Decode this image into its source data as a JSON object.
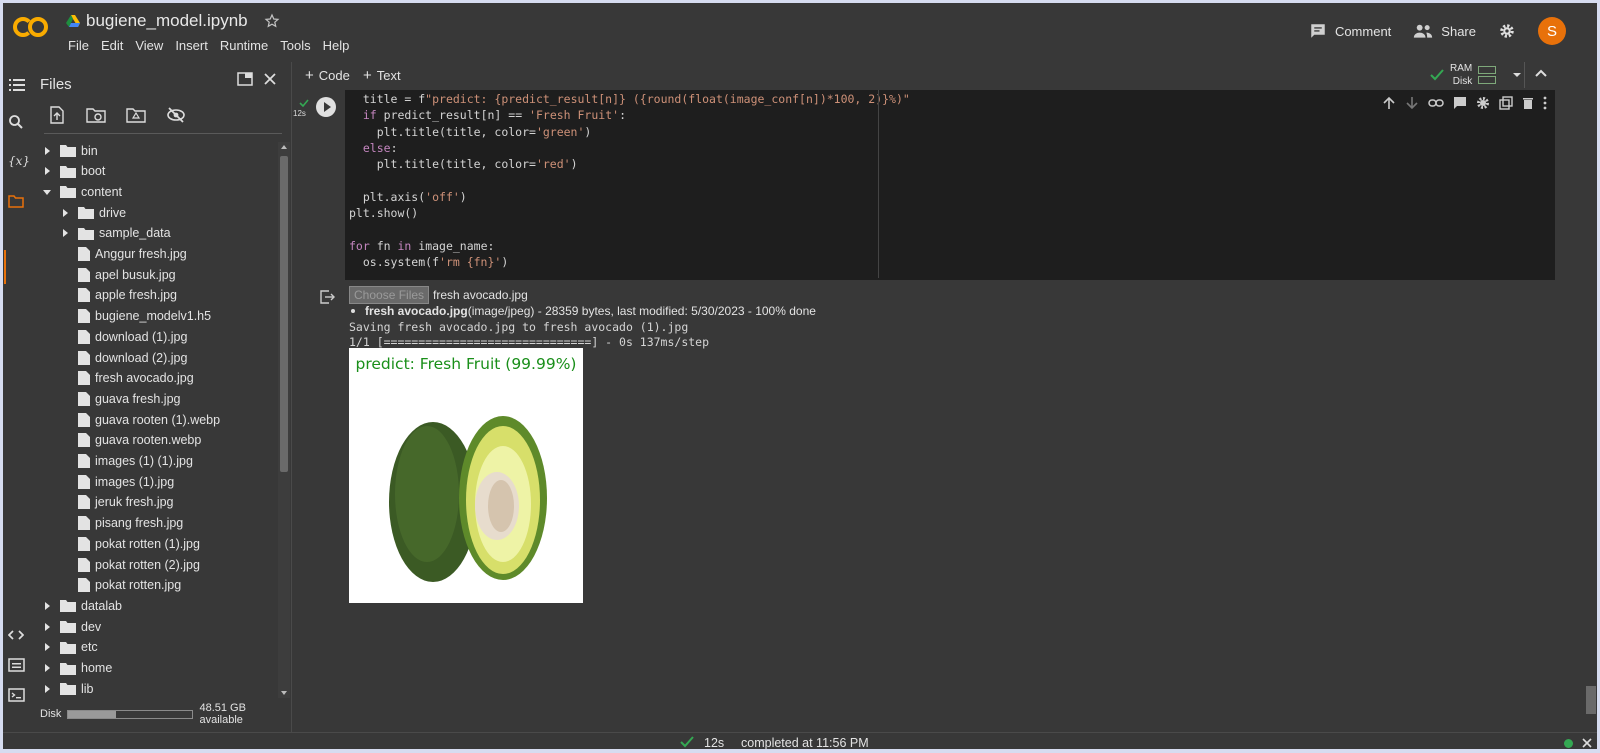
{
  "app": {
    "doc_title": "bugiene_model.ipynb",
    "menu": [
      "File",
      "Edit",
      "View",
      "Insert",
      "Runtime",
      "Tools",
      "Help"
    ],
    "comment_label": "Comment",
    "share_label": "Share",
    "avatar_letter": "S"
  },
  "colors": {
    "accent": "#e8710a",
    "check": "#34a853",
    "green_title": "#1a8f1a"
  },
  "files": {
    "title": "Files",
    "tree": [
      {
        "label": "bin",
        "kind": "folder",
        "depth": 0,
        "expanded": false
      },
      {
        "label": "boot",
        "kind": "folder",
        "depth": 0,
        "expanded": false
      },
      {
        "label": "content",
        "kind": "folder",
        "depth": 0,
        "expanded": true
      },
      {
        "label": "drive",
        "kind": "folder",
        "depth": 1,
        "expanded": false
      },
      {
        "label": "sample_data",
        "kind": "folder",
        "depth": 1,
        "expanded": false
      },
      {
        "label": "Anggur fresh.jpg",
        "kind": "file",
        "depth": 1
      },
      {
        "label": "apel busuk.jpg",
        "kind": "file",
        "depth": 1
      },
      {
        "label": "apple fresh.jpg",
        "kind": "file",
        "depth": 1
      },
      {
        "label": "bugiene_modelv1.h5",
        "kind": "file",
        "depth": 1
      },
      {
        "label": "download (1).jpg",
        "kind": "file",
        "depth": 1
      },
      {
        "label": "download (2).jpg",
        "kind": "file",
        "depth": 1
      },
      {
        "label": "fresh avocado.jpg",
        "kind": "file",
        "depth": 1
      },
      {
        "label": "guava fresh.jpg",
        "kind": "file",
        "depth": 1
      },
      {
        "label": "guava rooten (1).webp",
        "kind": "file",
        "depth": 1
      },
      {
        "label": "guava rooten.webp",
        "kind": "file",
        "depth": 1
      },
      {
        "label": "images (1) (1).jpg",
        "kind": "file",
        "depth": 1
      },
      {
        "label": "images (1).jpg",
        "kind": "file",
        "depth": 1
      },
      {
        "label": "jeruk fresh.jpg",
        "kind": "file",
        "depth": 1
      },
      {
        "label": "pisang fresh.jpg",
        "kind": "file",
        "depth": 1
      },
      {
        "label": "pokat rotten (1).jpg",
        "kind": "file",
        "depth": 1
      },
      {
        "label": "pokat rotten (2).jpg",
        "kind": "file",
        "depth": 1
      },
      {
        "label": "pokat rotten.jpg",
        "kind": "file",
        "depth": 1
      },
      {
        "label": "datalab",
        "kind": "folder",
        "depth": 0,
        "expanded": false
      },
      {
        "label": "dev",
        "kind": "folder",
        "depth": 0,
        "expanded": false
      },
      {
        "label": "etc",
        "kind": "folder",
        "depth": 0,
        "expanded": false
      },
      {
        "label": "home",
        "kind": "folder",
        "depth": 0,
        "expanded": false
      },
      {
        "label": "lib",
        "kind": "folder",
        "depth": 0,
        "expanded": false
      }
    ],
    "disk_label": "Disk",
    "disk_available": "48.51 GB available",
    "disk_used_fraction": 0.38
  },
  "toolbar": {
    "add_code": "Code",
    "add_text": "Text",
    "ram_label": "RAM",
    "disk_label": "Disk"
  },
  "cell": {
    "exec_time": "12s",
    "code_lines": [
      "  title = f\"predict: {predict_result[n]} ({round(float(image_conf[n])*100, 2)}%)\"",
      "  if predict_result[n] == 'Fresh Fruit':",
      "    plt.title(title, color='green')",
      "  else:",
      "    plt.title(title, color='red')",
      "",
      "  plt.axis('off')",
      "plt.show()",
      "",
      "for fn in image_name:",
      "  os.system(f'rm {fn}')"
    ]
  },
  "output": {
    "choose_files": "Choose Files",
    "chosen_file": "fresh avocado.jpg",
    "upload_name": "fresh avocado.jpg",
    "upload_detail": "(image/jpeg) - 28359 bytes, last modified: 5/30/2023 - 100% done",
    "saving_line": "Saving fresh avocado.jpg to fresh avocado (1).jpg",
    "progress_line": "1/1 [==============================] - 0s 137ms/step",
    "plot_title": "predict: Fresh Fruit (99.99%)"
  },
  "status": {
    "elapsed": "12s",
    "completed": "completed at 11:56 PM"
  }
}
